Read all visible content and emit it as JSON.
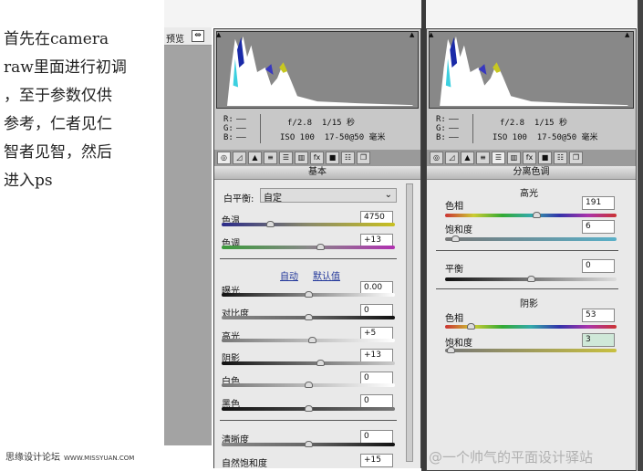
{
  "intro_lines": [
    "首先在camera",
    "raw里面进行初调",
    "，至于参数仅供",
    "参考，仁者见仁",
    "智者见智，然后",
    "进入ps"
  ],
  "watermark": {
    "site": "思缘设计论坛",
    "url": "WWW.MISSYUAN.COM",
    "weibo": "@一个帅气的平面设计驿站"
  },
  "preview_label": "预览",
  "info": {
    "r": "R:",
    "g": "G:",
    "b": "B:",
    "dash": "——",
    "exposure": "f/2.8  1/15 秒",
    "iso": "ISO 100  17-50@50 毫米"
  },
  "tools": [
    "◎",
    "◿",
    "▲",
    "≡",
    "☰",
    "▥",
    "fx",
    "■",
    "☷",
    "❐"
  ],
  "left": {
    "title": "基本",
    "white_balance_label": "白平衡:",
    "white_balance_value": "自定",
    "auto": "自动",
    "default": "默认值",
    "sliders": [
      {
        "label": "色温",
        "value": "4750",
        "pos": 0.28,
        "track": "linear-gradient(90deg,#2a2a8a,#8a8a6a,#c8c020)"
      },
      {
        "label": "色调",
        "value": "+13",
        "pos": 0.57,
        "track": "linear-gradient(90deg,#3a9a3a,#888,#b030b0)"
      },
      {
        "label": "曝光",
        "value": "0.00",
        "pos": 0.5,
        "track": "linear-gradient(90deg,#111,#fff)"
      },
      {
        "label": "对比度",
        "value": "0",
        "pos": 0.5,
        "track": "linear-gradient(90deg,#888,#666,#111)"
      },
      {
        "label": "高光",
        "value": "+5",
        "pos": 0.52,
        "track": "linear-gradient(90deg,#777,#fff)"
      },
      {
        "label": "阴影",
        "value": "+13",
        "pos": 0.57,
        "track": "linear-gradient(90deg,#111,#ccc)"
      },
      {
        "label": "白色",
        "value": "0",
        "pos": 0.5,
        "track": "linear-gradient(90deg,#777,#fff)"
      },
      {
        "label": "黑色",
        "value": "0",
        "pos": 0.5,
        "track": "linear-gradient(90deg,#111,#777)"
      },
      {
        "label": "清晰度",
        "value": "0",
        "pos": 0.5,
        "track": "linear-gradient(90deg,#888,#666,#111)"
      },
      {
        "label": "自然饱和度",
        "value": "+15",
        "pos": null,
        "track": ""
      }
    ]
  },
  "right": {
    "title": "分离色调",
    "highlights": "高光",
    "shadows": "阴影",
    "sliders": [
      {
        "label": "色相",
        "value": "191",
        "pos": 0.53,
        "track": "linear-gradient(90deg,#c33,#cc3,#3a3,#3aa,#33a,#a3a,#c33)"
      },
      {
        "label": "饱和度",
        "value": "6",
        "pos": 0.06,
        "track": "linear-gradient(90deg,#777,#5ab0c8)"
      },
      {
        "label": "平衡",
        "value": "0",
        "pos": 0.5,
        "track": "linear-gradient(90deg,#111,#ddd)"
      },
      {
        "label": "色相",
        "value": "53",
        "pos": 0.15,
        "track": "linear-gradient(90deg,#c33,#cc3,#3a3,#3aa,#33a,#a3a,#c33)"
      },
      {
        "label": "饱和度",
        "value": "3",
        "pos": 0.03,
        "track": "linear-gradient(90deg,#777,#c8c040)"
      }
    ]
  }
}
